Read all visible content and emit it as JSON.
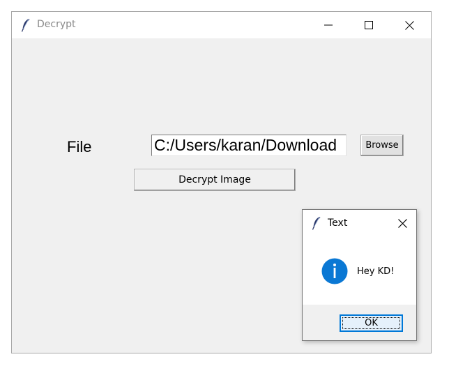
{
  "main_window": {
    "title": "Decrypt",
    "icon": "tk-feather-icon",
    "controls": [
      "minimize-icon",
      "maximize-icon",
      "close-icon"
    ]
  },
  "form": {
    "file_label": "File",
    "file_path_value": "C:/Users/karan/Download",
    "browse_label": "Browse",
    "decrypt_label": "Decrypt Image"
  },
  "message_box": {
    "title": "Text",
    "icon": "info-icon",
    "message": "Hey KD!",
    "ok_label": "OK"
  },
  "colors": {
    "window_bg": "#f0f0f0",
    "titlebar_bg": "#ffffff",
    "info_blue": "#0078d7",
    "ok_border": "#0078d7"
  }
}
